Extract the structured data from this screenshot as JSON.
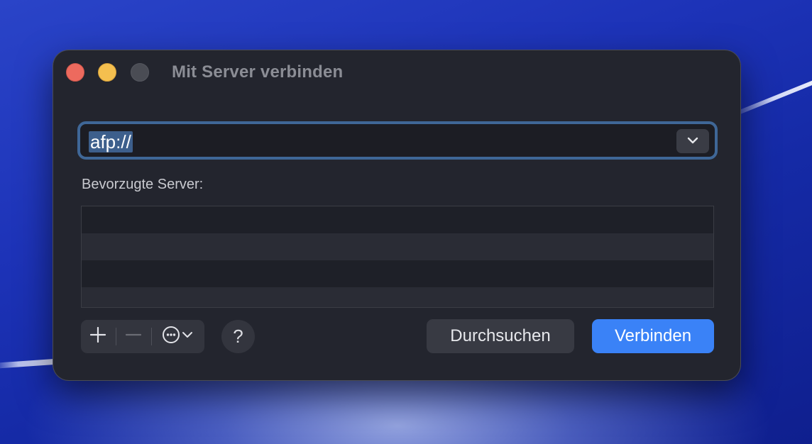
{
  "window": {
    "title": "Mit Server verbinden"
  },
  "address": {
    "value": "afp://",
    "dropdown_icon": "chevron-down-icon"
  },
  "favorites": {
    "label": "Bevorzugte Server:",
    "rows": [
      "",
      "",
      "",
      ""
    ]
  },
  "toolbar": {
    "add_icon": "plus-icon",
    "remove_icon": "minus-icon",
    "more_icon": "ellipsis-circle-icon",
    "help_label": "?"
  },
  "buttons": {
    "browse_label": "Durchsuchen",
    "connect_label": "Verbinden"
  },
  "colors": {
    "accent": "#3a82f7",
    "focus_ring": "#3f6797",
    "close": "#ed6a5e",
    "minimize": "#f4bf4f"
  }
}
